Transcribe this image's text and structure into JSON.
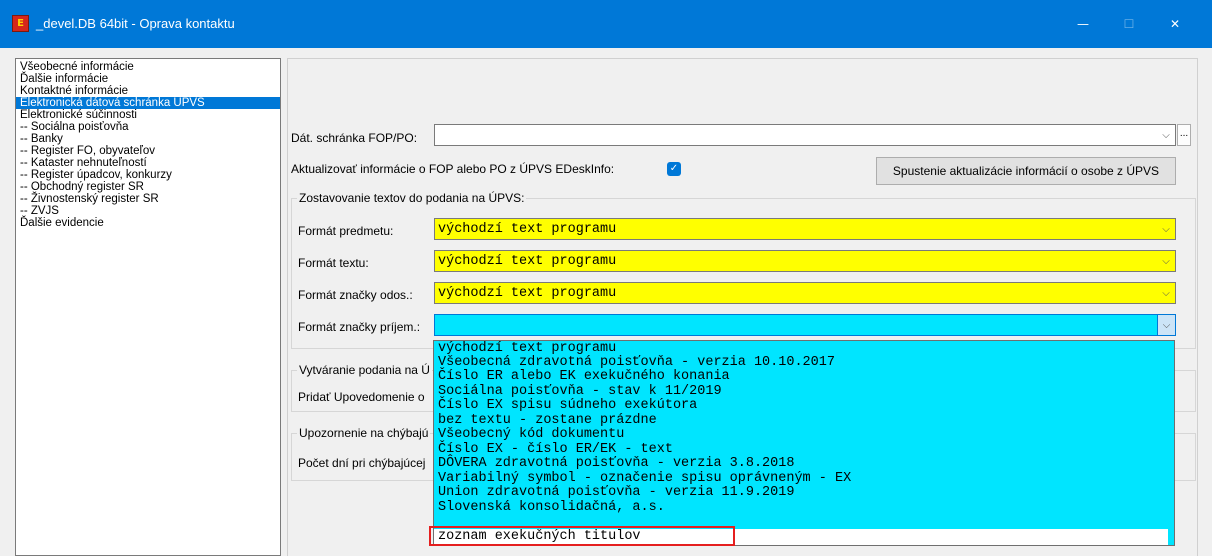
{
  "window": {
    "title": "_devel.DB 64bit - Oprava kontaktu",
    "app_icon_glyph": "E",
    "minimize": "—",
    "maximize": "☐",
    "close": "✕"
  },
  "tree": {
    "items": [
      {
        "label": "Všeobecné informácie",
        "selected": false,
        "child": false
      },
      {
        "label": "Ďalšie informácie",
        "selected": false,
        "child": false
      },
      {
        "label": "Kontaktné informácie",
        "selected": false,
        "child": false
      },
      {
        "label": "Elektronická dátová schránka ÚPVS",
        "selected": true,
        "child": false
      },
      {
        "label": "Elektronické súčinnosti",
        "selected": false,
        "child": false
      },
      {
        "label": "-- Sociálna poisťovňa",
        "selected": false,
        "child": true
      },
      {
        "label": "-- Banky",
        "selected": false,
        "child": true
      },
      {
        "label": "-- Register FO, obyvateľov",
        "selected": false,
        "child": true
      },
      {
        "label": "-- Kataster nehnuteľností",
        "selected": false,
        "child": true
      },
      {
        "label": "-- Register úpadcov, konkurzy",
        "selected": false,
        "child": true
      },
      {
        "label": "-- Obchodný register SR",
        "selected": false,
        "child": true
      },
      {
        "label": "-- Živnostenský register SR",
        "selected": false,
        "child": true
      },
      {
        "label": "-- ZVJS",
        "selected": false,
        "child": true
      },
      {
        "label": "Ďalšie evidencie",
        "selected": false,
        "child": false
      }
    ]
  },
  "form": {
    "mailbox_label": "Dát. schránka FOP/PO:",
    "mailbox_value": "",
    "browse_label": "...",
    "update_label": "Aktualizovať informácie o FOP alebo PO z ÚPVS EDeskInfo:",
    "update_checked": "✓",
    "update_button": "Spustenie aktualizácie informácií o osobe z ÚPVS",
    "group_compose_title": "Zostavovanie textov do podania na ÚPVS:",
    "subject_label": "Formát predmetu:",
    "subject_value": "východzí text programu",
    "text_label": "Formát textu:",
    "text_value": "východzí text programu",
    "sender_label": "Formát značky odos.:",
    "sender_value": "východzí text programu",
    "recipient_label": "Formát značky príjem.:",
    "recipient_value": "",
    "group_create_title": "Vytváranie podania na Ú",
    "notify_label": "Pridať Upovedomenie o",
    "group_missing_title": "Upozornenie na chýbajú",
    "days_label": "Počet dní pri chýbajúcej",
    "arrow": "⌵"
  },
  "dropdown": {
    "options": [
      "východzí text programu",
      "Všeobecná zdravotná poisťovňa - verzia 10.10.2017",
      "Číslo ER alebo EK exekučného konania",
      "Sociálna poisťovňa - stav k 11/2019",
      "Číslo EX spisu súdneho exekútora",
      "bez textu - zostane prázdne",
      "Všeobecný kód dokumentu",
      "Číslo EX - číslo ER/EK - text",
      "DÔVERA zdravotná poisťovňa - verzia 3.8.2018",
      "Variabilný symbol - označenie spisu oprávneným - EX",
      "Union zdravotná poisťovňa - verzia 11.9.2019",
      "Slovenská konsolidačná, a.s.",
      "zoznam exekučných titulov"
    ]
  },
  "colors": {
    "titlebar": "#0078d7",
    "selection": "#0078d7",
    "format_default_bg": "#ffff00",
    "dropdown_bg": "#00e5ff",
    "highlight_border": "#e51f1f"
  }
}
